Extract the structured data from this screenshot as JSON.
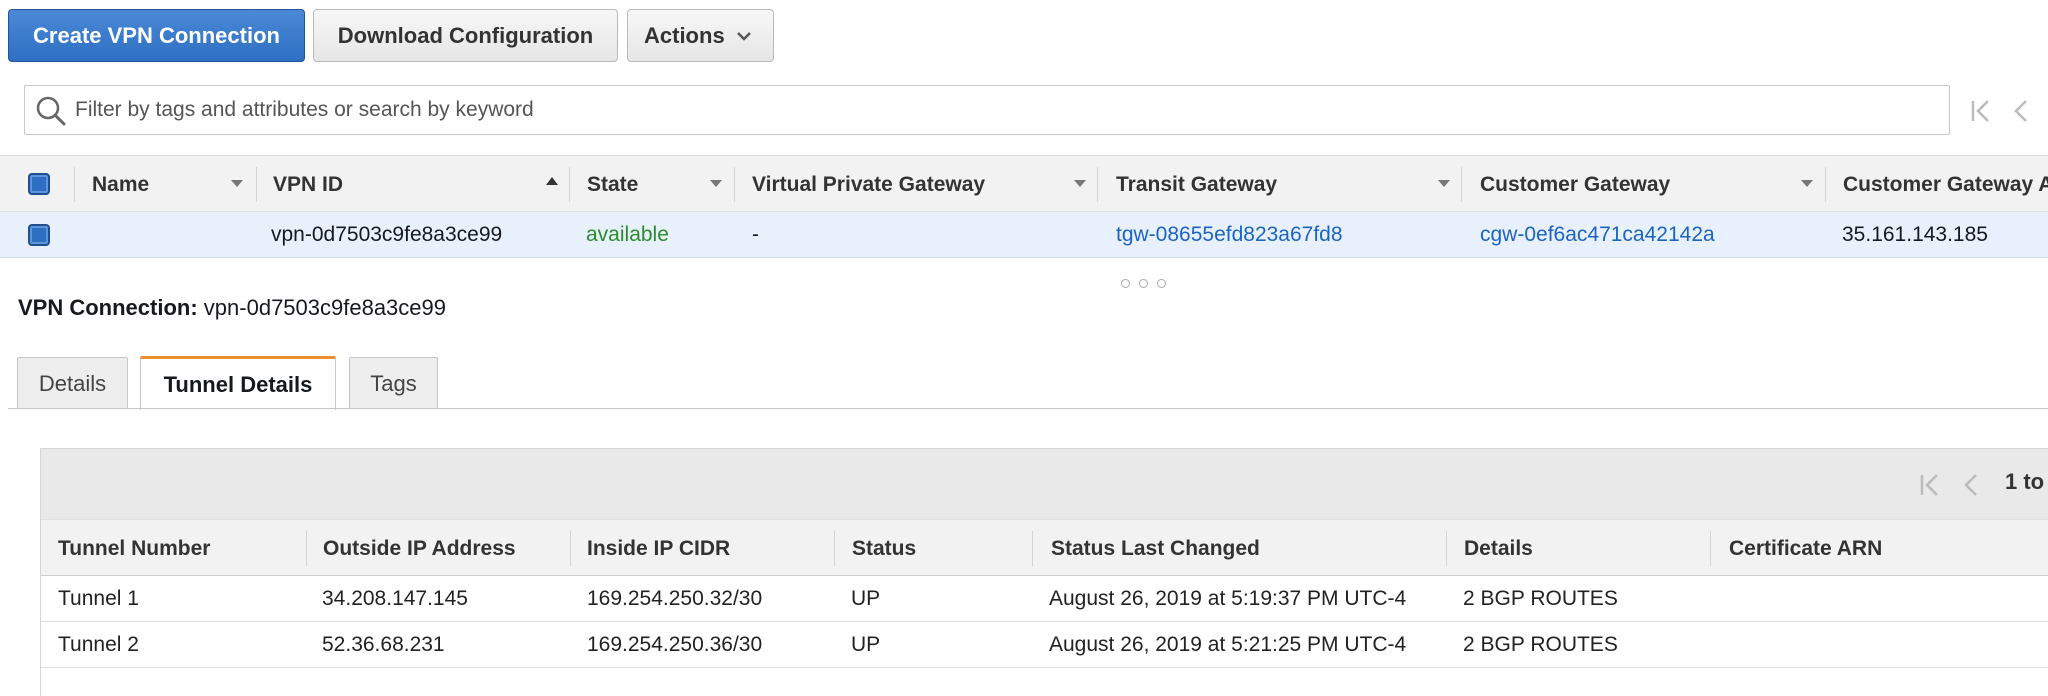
{
  "toolbar": {
    "create_label": "Create VPN Connection",
    "download_label": "Download Configuration",
    "actions_label": "Actions"
  },
  "search": {
    "placeholder": "Filter by tags and attributes or search by keyword"
  },
  "grid": {
    "columns": [
      "Name",
      "VPN ID",
      "State",
      "Virtual Private Gateway",
      "Transit Gateway",
      "Customer Gateway",
      "Customer Gateway A"
    ],
    "rows": [
      {
        "name": "",
        "vpn_id": "vpn-0d7503c9fe8a3ce99",
        "state": "available",
        "vpg": "-",
        "transit_gateway": "tgw-08655efd823a67fd8",
        "customer_gateway": "cgw-0ef6ac471ca42142a",
        "customer_gateway_address": "35.161.143.185"
      }
    ]
  },
  "detail": {
    "label": "VPN Connection:",
    "value": "vpn-0d7503c9fe8a3ce99",
    "tabs": [
      "Details",
      "Tunnel Details",
      "Tags"
    ],
    "active_tab": "Tunnel Details"
  },
  "tunnels": {
    "pager_text": "1 to",
    "columns": [
      "Tunnel Number",
      "Outside IP Address",
      "Inside IP CIDR",
      "Status",
      "Status Last Changed",
      "Details",
      "Certificate ARN"
    ],
    "rows": [
      {
        "tunnel": "Tunnel 1",
        "outside_ip": "34.208.147.145",
        "inside_cidr": "169.254.250.32/30",
        "status": "UP",
        "changed": "August 26, 2019 at 5:19:37 PM UTC-4",
        "details": "2 BGP ROUTES",
        "cert": ""
      },
      {
        "tunnel": "Tunnel 2",
        "outside_ip": "52.36.68.231",
        "inside_cidr": "169.254.250.36/30",
        "status": "UP",
        "changed": "August 26, 2019 at 5:21:25 PM UTC-4",
        "details": "2 BGP ROUTES",
        "cert": ""
      }
    ]
  },
  "colors": {
    "primary": "#2f6fc2",
    "link": "#1b64c4",
    "status_ok": "#2c8b2c",
    "tab_accent": "#e8912d",
    "selected_row": "#e8f1fb"
  }
}
